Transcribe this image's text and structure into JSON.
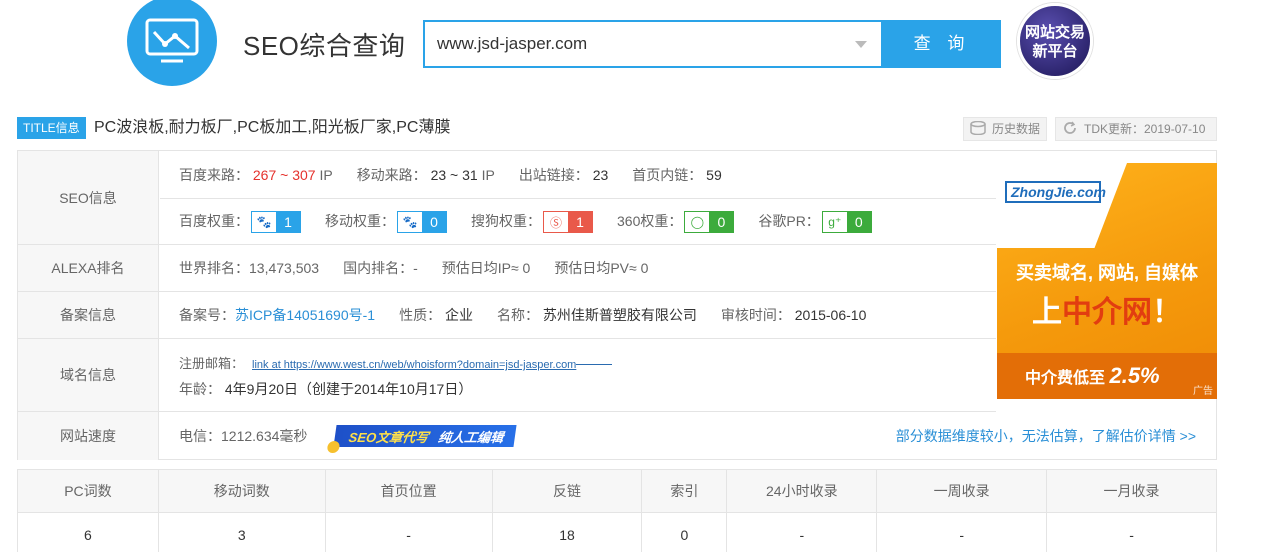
{
  "header": {
    "app_title": "SEO综合查询",
    "search_value": "www.jsd-jasper.com",
    "search_button": "查 询",
    "promo_line1": "网站交易",
    "promo_line2": "新平台"
  },
  "title_row": {
    "tag": "TITLE信息",
    "text": "PC波浪板,耐力板厂,PC板加工,阳光板厂家,PC薄膜",
    "history_button": "历史数据",
    "tdk_update": "TDK更新：2019-07-10"
  },
  "seo_info": {
    "label": "SEO信息",
    "baidu_traffic_label": "百度来路：",
    "baidu_traffic_value": "267 ~ 307",
    "baidu_traffic_unit": "IP",
    "mobile_traffic_label": "移动来路：",
    "mobile_traffic_value": "23 ~ 31",
    "mobile_traffic_unit": "IP",
    "outbound_label": "出站链接：",
    "outbound_value": "23",
    "homepage_links_label": "首页内链：",
    "homepage_links_value": "59",
    "baidu_weight_label": "百度权重：",
    "baidu_weight_value": "1",
    "mobile_weight_label": "移动权重：",
    "mobile_weight_value": "0",
    "sogou_weight_label": "搜狗权重：",
    "sogou_weight_value": "1",
    "weight360_label": "360权重：",
    "weight360_value": "0",
    "google_pr_label": "谷歌PR：",
    "google_pr_value": "0"
  },
  "alexa": {
    "label": "ALEXA排名",
    "world_rank": "世界排名：13,473,503",
    "domestic_rank": "国内排名：-",
    "daily_ip": "预估日均IP≈ 0",
    "daily_pv": "预估日均PV≈ 0"
  },
  "beian": {
    "label": "备案信息",
    "number_label": "备案号：",
    "number_value": "苏ICP备14051690号-1",
    "nature_label": "性质：",
    "nature_value": "企业",
    "name_label": "名称：",
    "name_value": "苏州佳斯普塑胶有限公司",
    "audit_label": "审核时间：",
    "audit_value": "2015-06-10"
  },
  "domain": {
    "label": "域名信息",
    "email_label": "注册邮箱：",
    "email_value": "link at https://www.west.cn/web/whoisform?domain=jsd-jasper.com",
    "age_label": "年龄：",
    "age_value": "4年9月20日（创建于2014年10月17日）"
  },
  "speed": {
    "label": "网站速度",
    "telecom": "电信：1212.634毫秒",
    "ribbon_a": "SEO文章代写",
    "ribbon_b": "纯人工编辑",
    "note_link": "部分数据维度较小，无法估算，了解估价详情 >>"
  },
  "ad": {
    "brand": "ZhongJie.com",
    "line1": "买卖域名, 网站, 自媒体",
    "line2_pre": "上",
    "line2_hl": "中介网",
    "line2_post": "！",
    "line3": "中介费低至",
    "line3_pct": "2.5%",
    "tag": "广告"
  },
  "stats": {
    "headers": [
      "PC词数",
      "移动词数",
      "首页位置",
      "反链",
      "索引",
      "24小时收录",
      "一周收录",
      "一月收录"
    ],
    "values": [
      "6",
      "3",
      "-",
      "18",
      "0",
      "-",
      "-",
      "-"
    ]
  },
  "colors": {
    "accent": "#2aa3e8",
    "red": "#e5322d",
    "ad_orange": "#f59a0c"
  }
}
